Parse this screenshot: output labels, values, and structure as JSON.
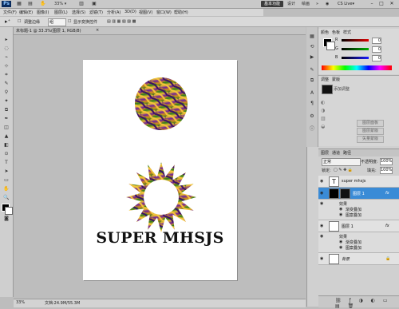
{
  "appbar": {
    "logo": "Ps",
    "zoom": "33%",
    "workspace": "基本功能",
    "workspace_buttons": [
      "设计",
      "绘画"
    ],
    "cs_live": "CS Live▾",
    "win_controls": [
      "–",
      "□",
      "✕"
    ]
  },
  "menu": [
    "文件(F)",
    "编辑(E)",
    "图像(I)",
    "图层(L)",
    "选择(S)",
    "滤镜(T)",
    "分析(A)",
    "3D(D)",
    "视图(V)",
    "窗口(W)",
    "帮助(H)"
  ],
  "options": {
    "mode_label": "调整边缘",
    "select_value": "组",
    "checkbox_label": "显示变换控件"
  },
  "tools": [
    "▸",
    "◌",
    "⌁",
    "⊹",
    "⌗",
    "✎",
    "⚲",
    "✦",
    "⧉",
    "✒",
    "◫",
    "▲",
    "◧",
    "⊙",
    "T",
    "➤",
    "▭",
    "✋",
    "🔍"
  ],
  "document": {
    "tab_label": "未标题-1 @ 33.3%(图层 1, RGB/8)",
    "tab_close": "×",
    "canvas_text": "SUPER MHSJS",
    "zoom_status": "33%",
    "doc_status": "文档:24.9M/55.3M"
  },
  "color_panel": {
    "tabs": [
      "颜色",
      "色板",
      "样式"
    ],
    "sliders": [
      {
        "label": "R",
        "value": "0",
        "color": "#e00000"
      },
      {
        "label": "G",
        "value": "0",
        "color": "#00b000"
      },
      {
        "label": "B",
        "value": "0",
        "color": "#1a1aff"
      }
    ]
  },
  "adjustments": {
    "tabs": [
      "调整",
      "蒙版"
    ],
    "header": "添加调整",
    "buttons": [
      "图层面板",
      "图层蒙版",
      "矢量蒙版"
    ]
  },
  "layers": {
    "tabs": [
      "图层",
      "通道",
      "路径"
    ],
    "blend_mode": "正常",
    "opacity_label": "不透明度:",
    "opacity_value": "100%",
    "lock_label": "锁定:",
    "fill_label": "填充:",
    "fill_value": "100%",
    "items": [
      {
        "name": "super mhsjs",
        "type": "text",
        "selected": false,
        "effects": []
      },
      {
        "name": "图层 1",
        "type": "layer",
        "selected": true,
        "effects_title": "效果",
        "effects": [
          "渐变叠加",
          "图案叠加"
        ]
      },
      {
        "name": "图层 1",
        "type": "layer",
        "selected": false,
        "effects_title": "效果",
        "effects": [
          "渐变叠加",
          "图案叠加"
        ]
      },
      {
        "name": "背景",
        "type": "background",
        "selected": false,
        "effects": []
      }
    ],
    "fx_label": "fx"
  }
}
